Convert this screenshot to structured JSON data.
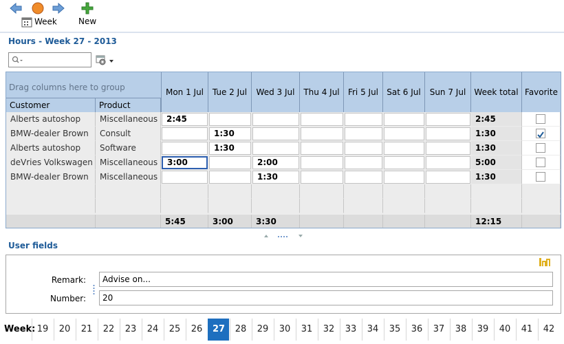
{
  "toolbar": {
    "week_label": "Week",
    "new_label": "New",
    "icons": [
      "back-arrow-icon",
      "home-icon",
      "forward-arrow-icon",
      "calendar-icon",
      "plus-icon"
    ]
  },
  "title": "Hours - Week 27 - 2013",
  "search": {
    "placeholder": ""
  },
  "grid": {
    "group_hint": "Drag columns here to group",
    "columns": {
      "customer": "Customer",
      "product": "Product",
      "days": [
        "Mon 1 Jul",
        "Tue 2 Jul",
        "Wed 3 Jul",
        "Thu 4 Jul",
        "Fri 5 Jul",
        "Sat 6 Jul",
        "Sun 7 Jul"
      ],
      "week_total": "Week total",
      "favorite": "Favorite"
    },
    "rows": [
      {
        "customer": "Alberts autoshop",
        "product": "Miscellaneous",
        "hours": [
          "2:45",
          "",
          "",
          "",
          "",
          "",
          ""
        ],
        "total": "2:45",
        "favorite": false
      },
      {
        "customer": "BMW-dealer Brown",
        "product": "Consult",
        "hours": [
          "",
          "1:30",
          "",
          "",
          "",
          "",
          ""
        ],
        "total": "1:30",
        "favorite": true
      },
      {
        "customer": "Alberts autoshop",
        "product": "Software",
        "hours": [
          "",
          "1:30",
          "",
          "",
          "",
          "",
          ""
        ],
        "total": "1:30",
        "favorite": false
      },
      {
        "customer": "deVries Volkswagen",
        "product": "Miscellaneous",
        "hours": [
          "3:00",
          "",
          "2:00",
          "",
          "",
          "",
          ""
        ],
        "total": "5:00",
        "favorite": false
      },
      {
        "customer": "BMW-dealer Brown",
        "product": "Miscellaneous",
        "hours": [
          "",
          "",
          "1:30",
          "",
          "",
          "",
          ""
        ],
        "total": "1:30",
        "favorite": false
      }
    ],
    "totals": [
      "5:45",
      "3:00",
      "3:30",
      "",
      "",
      "",
      ""
    ],
    "grand_total": "12:15"
  },
  "user_fields": {
    "title": "User fields",
    "remark_label": "Remark:",
    "remark_value": "Advise on...",
    "number_label": "Number:",
    "number_value": "20"
  },
  "weeks": {
    "label": "Week:",
    "items": [
      "19",
      "20",
      "21",
      "22",
      "23",
      "24",
      "25",
      "26",
      "27",
      "28",
      "29",
      "30",
      "31",
      "32",
      "33",
      "34",
      "35",
      "36",
      "37",
      "38",
      "39",
      "40",
      "41",
      "42"
    ],
    "active": "27"
  },
  "colors": {
    "accent": "#1e6fbf",
    "title": "#1e5b98",
    "header_bg": "#b8cfe8"
  }
}
